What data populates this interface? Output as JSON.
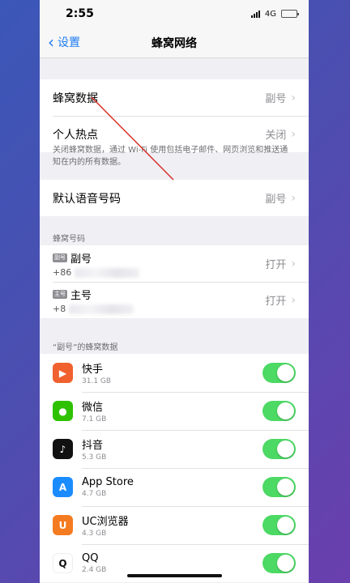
{
  "status": {
    "time": "2:55",
    "network": "4G"
  },
  "nav": {
    "back_label": "设置",
    "title": "蜂窝网络"
  },
  "cellular_group": {
    "rows": [
      {
        "label": "蜂窝数据",
        "value": "副号"
      },
      {
        "label": "个人热点",
        "value": "关闭"
      }
    ],
    "footnote": "关闭蜂窝数据，通过 Wi-Fi 使用包括电子邮件、网页浏览和推送通知在内的所有数据。"
  },
  "voice_row": {
    "label": "默认语音号码",
    "value": "副号"
  },
  "numbers_section": {
    "header": "蜂窝号码",
    "items": [
      {
        "badge": "副号",
        "name": "副号",
        "number_prefix": "+86",
        "value": "打开"
      },
      {
        "badge": "主号",
        "name": "主号",
        "number_prefix": "+8",
        "value": "打开"
      }
    ]
  },
  "apps_section": {
    "header": "“副号”的蜂窝数据",
    "apps": [
      {
        "name": "快手",
        "size": "31.1 GB",
        "icon": "kuaishou-icon",
        "color": "#f0612f",
        "on": true
      },
      {
        "name": "微信",
        "size": "7.1 GB",
        "icon": "wechat-icon",
        "color": "#2dc100",
        "on": true
      },
      {
        "name": "抖音",
        "size": "5.3 GB",
        "icon": "douyin-icon",
        "color": "#111111",
        "on": true
      },
      {
        "name": "App Store",
        "size": "4.7 GB",
        "icon": "app-store-icon",
        "color": "#1a8cff",
        "on": true
      },
      {
        "name": "UC浏览器",
        "size": "4.3 GB",
        "icon": "uc-browser-icon",
        "color": "#f47b20",
        "on": true
      },
      {
        "name": "QQ",
        "size": "2.4 GB",
        "icon": "qq-icon",
        "color": "#ffffff",
        "on": true
      }
    ]
  },
  "colors": {
    "accent": "#1e7cf2",
    "toggle_on": "#4cd964",
    "annotation": "#d8312a"
  }
}
